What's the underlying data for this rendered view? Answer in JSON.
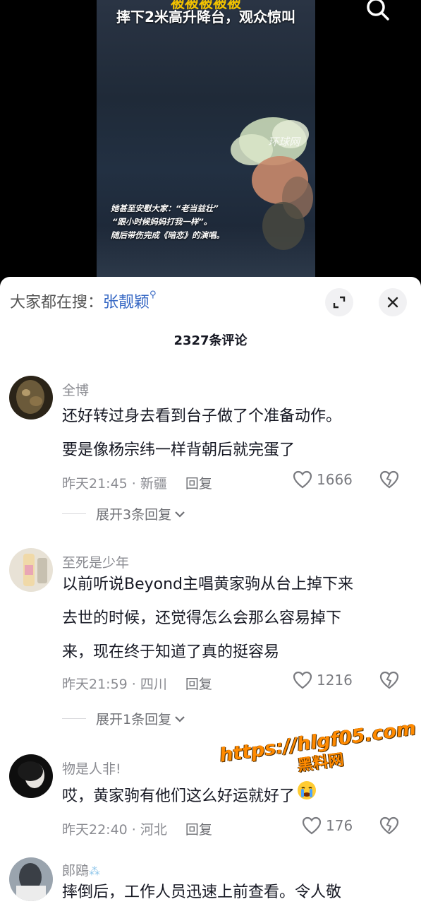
{
  "video": {
    "top_caption_partial": "被被被被被",
    "top_caption": "摔下2米高升降台，观众惊叫",
    "watermark": "环球网",
    "sub_caption": [
      "她甚至安慰大家：“老当益壮”",
      "“跟小时候妈妈打我一样”。",
      "随后带伤完成《暗恋》的演唱。"
    ],
    "search_icon": "search-icon"
  },
  "panel": {
    "search_hint_prefix": "大家都在搜：",
    "search_hint_term": "张靓颖",
    "comment_count": "2327条评论"
  },
  "comments": [
    {
      "user": "全博",
      "lines": [
        "还好转过身去看到台子做了个准备动作。",
        "要是像杨宗纬一样背朝后就完蛋了"
      ],
      "time_loc": "昨天21:45 · 新疆",
      "reply": "回复",
      "likes": "1666",
      "expand": "展开3条回复"
    },
    {
      "user": "至死是少年",
      "lines": [
        "以前听说Beyond主唱黄家驹从台上掉下来",
        "去世的时候，还觉得怎么会那么容易掉下",
        "来，现在终于知道了真的挺容易"
      ],
      "time_loc": "昨天21:59 · 四川",
      "reply": "回复",
      "likes": "1216",
      "expand": "展开1条回复"
    },
    {
      "user": "物是人非!",
      "lines": [
        "哎，黄家驹有他们这么好运就好了"
      ],
      "time_loc": "昨天22:40 · 河北",
      "reply": "回复",
      "likes": "176"
    },
    {
      "user": "郞鴎",
      "lines": [
        "摔倒后，工作人员迅速上前查看。令人敬"
      ]
    }
  ],
  "overlay_watermark": {
    "url": "https://hlgf05.com",
    "sub": "黑料网"
  },
  "colors": {
    "accent_blue": "#3768c4",
    "text_primary": "#161823",
    "text_secondary": "#8a8b91",
    "caption_yellow": "#f2c200",
    "watermark_orange": "#ff8a00"
  }
}
